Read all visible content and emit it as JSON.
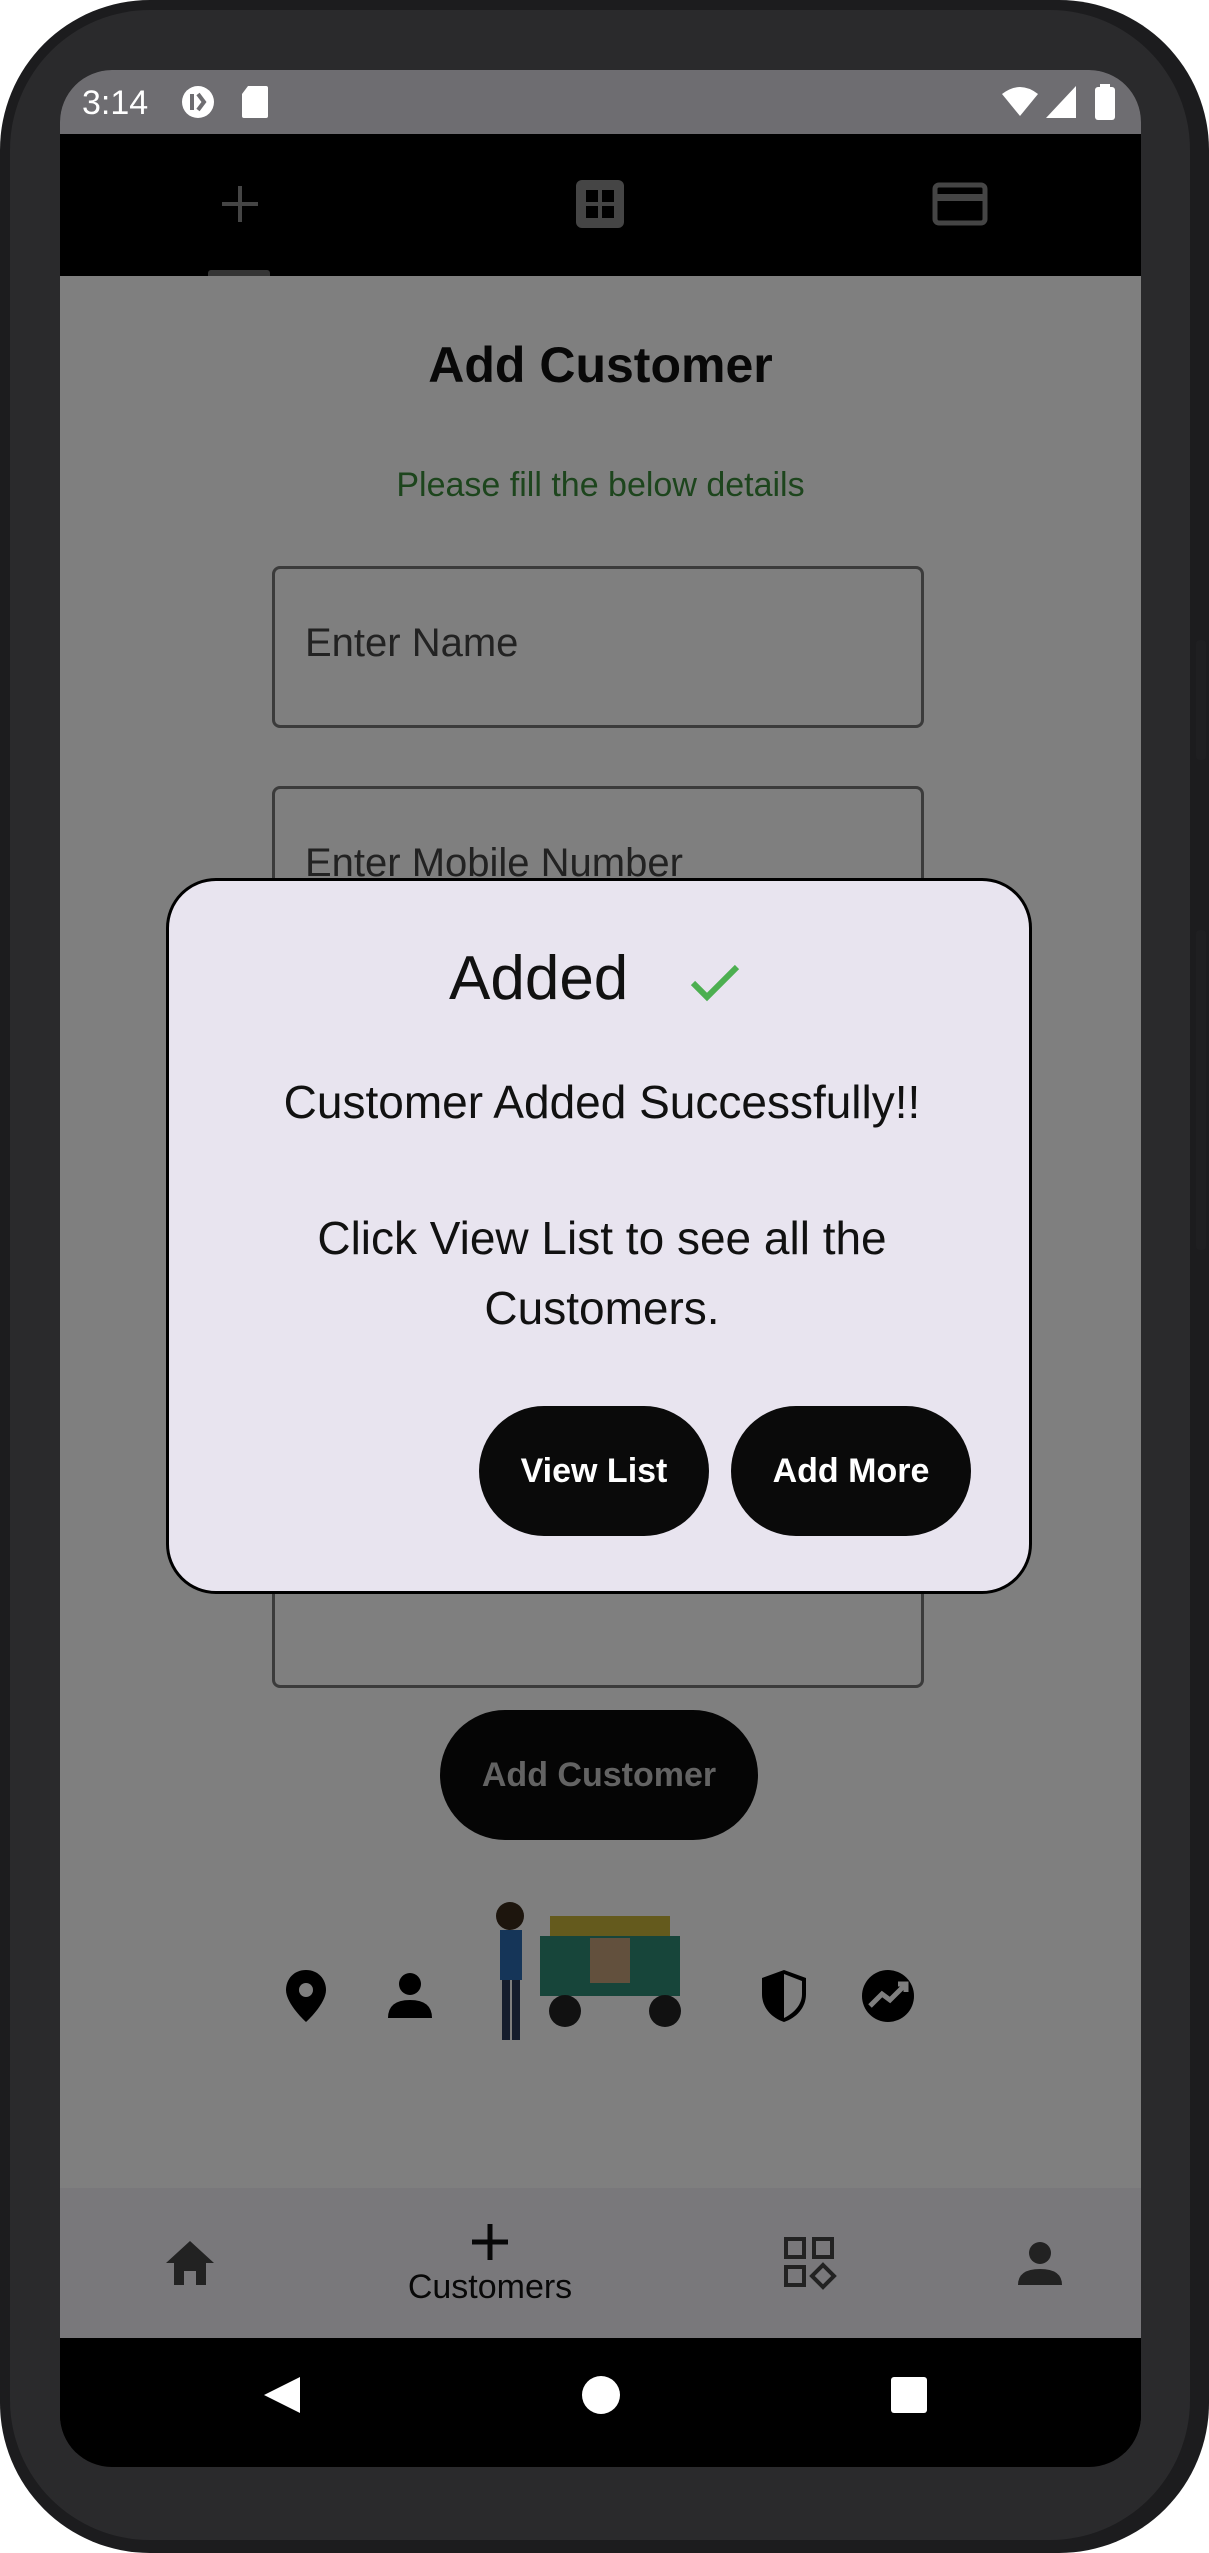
{
  "status_bar": {
    "time": "3:14"
  },
  "top_tabs": [
    {
      "icon": "plus-icon"
    },
    {
      "icon": "grid-icon"
    },
    {
      "icon": "card-icon"
    }
  ],
  "form": {
    "title": "Add Customer",
    "subtitle": "Please fill the below details",
    "name_placeholder": "Enter Name",
    "mobile_placeholder": "Enter Mobile Number",
    "submit_label": "Add Customer"
  },
  "footer_icons": [
    "location-pin-icon",
    "person-icon",
    "illustration",
    "shield-icon",
    "trend-icon"
  ],
  "bottom_nav": {
    "items": [
      {
        "icon": "home-icon",
        "label": ""
      },
      {
        "icon": "plus-icon",
        "label": "Customers"
      },
      {
        "icon": "widgets-icon",
        "label": ""
      },
      {
        "icon": "person-icon",
        "label": ""
      }
    ]
  },
  "dialog": {
    "title": "Added",
    "message_line1": "Customer Added Successfully!!",
    "message_line2": "Click View List to see all the Customers.",
    "view_list_label": "View List",
    "add_more_label": "Add More"
  },
  "colors": {
    "subtitle": "#3a8a3a",
    "check": "#4caf50",
    "dialog_bg": "#e8e4ef",
    "button_bg": "#0a0a0a"
  }
}
